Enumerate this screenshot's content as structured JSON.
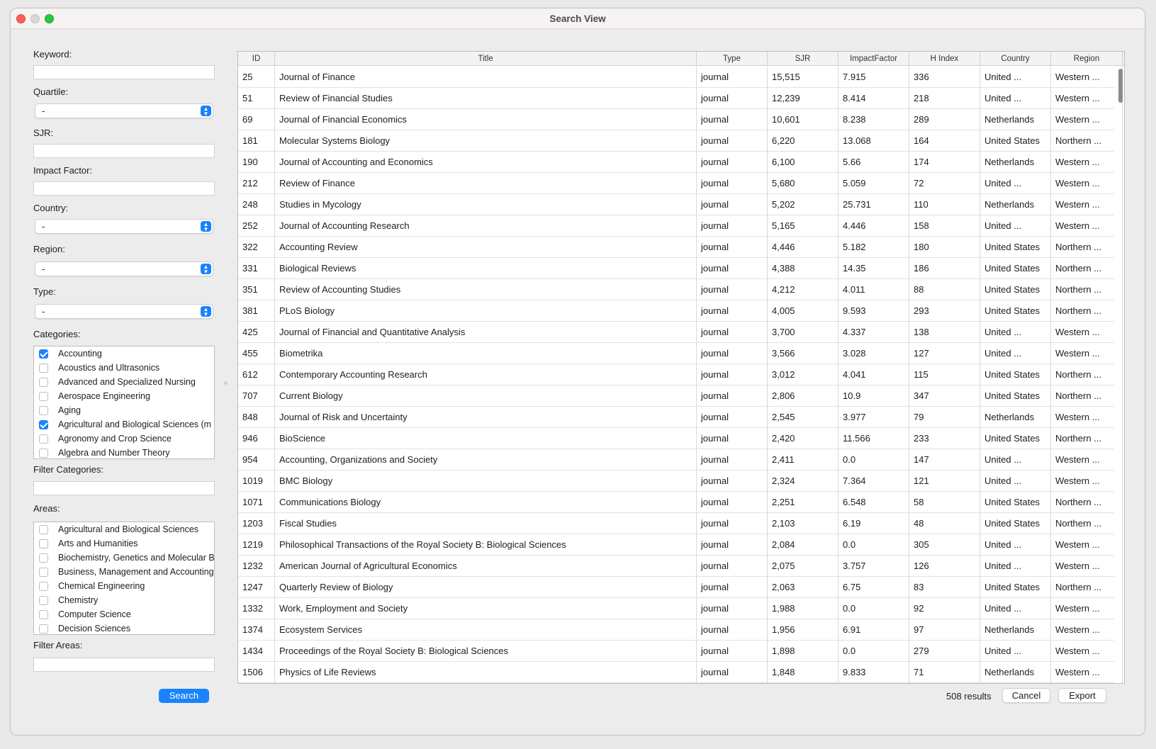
{
  "window": {
    "title": "Search View"
  },
  "form": {
    "keyword_label": "Keyword:",
    "keyword_value": "",
    "quartile_label": "Quartile:",
    "quartile_value": "-",
    "sjr_label": "SJR:",
    "sjr_value": "",
    "impact_label": "Impact Factor:",
    "impact_value": "",
    "country_label": "Country:",
    "country_value": "-",
    "region_label": "Region:",
    "region_value": "-",
    "type_label": "Type:",
    "type_value": "-",
    "categories_label": "Categories:",
    "categories": [
      {
        "label": "Accounting",
        "checked": true
      },
      {
        "label": "Acoustics and Ultrasonics",
        "checked": false
      },
      {
        "label": "Advanced and Specialized Nursing",
        "checked": false
      },
      {
        "label": "Aerospace Engineering",
        "checked": false
      },
      {
        "label": "Aging",
        "checked": false
      },
      {
        "label": "Agricultural and Biological Sciences (m",
        "checked": true
      },
      {
        "label": "Agronomy and Crop Science",
        "checked": false
      },
      {
        "label": "Algebra and Number Theory",
        "checked": false
      }
    ],
    "filter_categories_label": "Filter Categories:",
    "filter_categories_value": "",
    "areas_label": "Areas:",
    "areas": [
      {
        "label": "Agricultural and Biological Sciences",
        "checked": false
      },
      {
        "label": "Arts and Humanities",
        "checked": false
      },
      {
        "label": "Biochemistry, Genetics and Molecular B",
        "checked": false
      },
      {
        "label": "Business, Management and Accounting",
        "checked": false
      },
      {
        "label": "Chemical Engineering",
        "checked": false
      },
      {
        "label": "Chemistry",
        "checked": false
      },
      {
        "label": "Computer Science",
        "checked": false
      },
      {
        "label": "Decision Sciences",
        "checked": false
      }
    ],
    "filter_areas_label": "Filter Areas:",
    "filter_areas_value": "",
    "search_label": "Search"
  },
  "table": {
    "columns": [
      "ID",
      "Title",
      "Type",
      "SJR",
      "ImpactFactor",
      "H Index",
      "Country",
      "Region"
    ],
    "rows": [
      [
        "25",
        "Journal of Finance",
        "journal",
        "15,515",
        "7.915",
        "336",
        "United ...",
        "Western ..."
      ],
      [
        "51",
        "Review of Financial Studies",
        "journal",
        "12,239",
        "8.414",
        "218",
        "United ...",
        "Western ..."
      ],
      [
        "69",
        "Journal of Financial Economics",
        "journal",
        "10,601",
        "8.238",
        "289",
        "Netherlands",
        "Western ..."
      ],
      [
        "181",
        "Molecular Systems Biology",
        "journal",
        "6,220",
        "13.068",
        "164",
        "United States",
        "Northern ..."
      ],
      [
        "190",
        "Journal of Accounting and Economics",
        "journal",
        "6,100",
        "5.66",
        "174",
        "Netherlands",
        "Western ..."
      ],
      [
        "212",
        "Review of Finance",
        "journal",
        "5,680",
        "5.059",
        "72",
        "United ...",
        "Western ..."
      ],
      [
        "248",
        "Studies in Mycology",
        "journal",
        "5,202",
        "25.731",
        "110",
        "Netherlands",
        "Western ..."
      ],
      [
        "252",
        "Journal of Accounting Research",
        "journal",
        "5,165",
        "4.446",
        "158",
        "United ...",
        "Western ..."
      ],
      [
        "322",
        "Accounting Review",
        "journal",
        "4,446",
        "5.182",
        "180",
        "United States",
        "Northern ..."
      ],
      [
        "331",
        "Biological Reviews",
        "journal",
        "4,388",
        "14.35",
        "186",
        "United States",
        "Northern ..."
      ],
      [
        "351",
        "Review of Accounting Studies",
        "journal",
        "4,212",
        "4.011",
        "88",
        "United States",
        "Northern ..."
      ],
      [
        "381",
        "PLoS Biology",
        "journal",
        "4,005",
        "9.593",
        "293",
        "United States",
        "Northern ..."
      ],
      [
        "425",
        "Journal of Financial and Quantitative Analysis",
        "journal",
        "3,700",
        "4.337",
        "138",
        "United ...",
        "Western ..."
      ],
      [
        "455",
        "Biometrika",
        "journal",
        "3,566",
        "3.028",
        "127",
        "United ...",
        "Western ..."
      ],
      [
        "612",
        "Contemporary Accounting Research",
        "journal",
        "3,012",
        "4.041",
        "115",
        "United States",
        "Northern ..."
      ],
      [
        "707",
        "Current Biology",
        "journal",
        "2,806",
        "10.9",
        "347",
        "United States",
        "Northern ..."
      ],
      [
        "848",
        "Journal of Risk and Uncertainty",
        "journal",
        "2,545",
        "3.977",
        "79",
        "Netherlands",
        "Western ..."
      ],
      [
        "946",
        "BioScience",
        "journal",
        "2,420",
        "11.566",
        "233",
        "United States",
        "Northern ..."
      ],
      [
        "954",
        "Accounting, Organizations and Society",
        "journal",
        "2,411",
        "0.0",
        "147",
        "United ...",
        "Western ..."
      ],
      [
        "1019",
        "BMC Biology",
        "journal",
        "2,324",
        "7.364",
        "121",
        "United ...",
        "Western ..."
      ],
      [
        "1071",
        "Communications Biology",
        "journal",
        "2,251",
        "6.548",
        "58",
        "United States",
        "Northern ..."
      ],
      [
        "1203",
        "Fiscal Studies",
        "journal",
        "2,103",
        "6.19",
        "48",
        "United States",
        "Northern ..."
      ],
      [
        "1219",
        "Philosophical Transactions of the Royal Society B: Biological Sciences",
        "journal",
        "2,084",
        "0.0",
        "305",
        "United ...",
        "Western ..."
      ],
      [
        "1232",
        "American Journal of Agricultural Economics",
        "journal",
        "2,075",
        "3.757",
        "126",
        "United ...",
        "Western ..."
      ],
      [
        "1247",
        "Quarterly Review of Biology",
        "journal",
        "2,063",
        "6.75",
        "83",
        "United States",
        "Northern ..."
      ],
      [
        "1332",
        "Work, Employment and Society",
        "journal",
        "1,988",
        "0.0",
        "92",
        "United ...",
        "Western ..."
      ],
      [
        "1374",
        "Ecosystem Services",
        "journal",
        "1,956",
        "6.91",
        "97",
        "Netherlands",
        "Western ..."
      ],
      [
        "1434",
        "Proceedings of the Royal Society B: Biological Sciences",
        "journal",
        "1,898",
        "0.0",
        "279",
        "United ...",
        "Western ..."
      ],
      [
        "1506",
        "Physics of Life Reviews",
        "journal",
        "1,848",
        "9.833",
        "71",
        "Netherlands",
        "Western ..."
      ]
    ]
  },
  "footer": {
    "results_text": "508 results",
    "cancel_label": "Cancel",
    "export_label": "Export"
  },
  "colors": {
    "accent": "#1a82fb",
    "close": "#fe5f57",
    "zoom": "#2bc840"
  }
}
